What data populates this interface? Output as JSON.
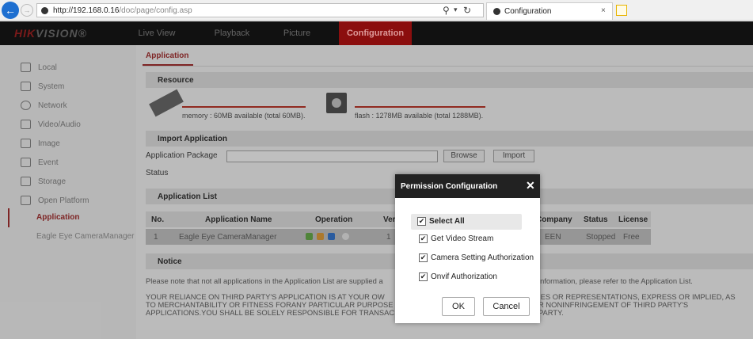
{
  "browser": {
    "url_host": "http://192.168.0.16",
    "url_path": "/doc/page/config.asp",
    "tab_title": "Configuration",
    "tab_close": "×"
  },
  "app": {
    "logo_red": "HIK",
    "logo_rest": "VISION",
    "logo_mark": "®",
    "nav": [
      "Live View",
      "Playback",
      "Picture",
      "Configuration"
    ],
    "accent": "#8b0e0e"
  },
  "sidebar": {
    "items": [
      {
        "label": "Local",
        "icon": "monitor-icon"
      },
      {
        "label": "System",
        "icon": "system-icon"
      },
      {
        "label": "Network",
        "icon": "globe-icon"
      },
      {
        "label": "Video/Audio",
        "icon": "video-audio-icon"
      },
      {
        "label": "Image",
        "icon": "image-icon"
      },
      {
        "label": "Event",
        "icon": "event-icon"
      },
      {
        "label": "Storage",
        "icon": "storage-icon"
      },
      {
        "label": "Open Platform",
        "icon": "platform-icon"
      }
    ],
    "subitems": [
      "Application",
      "Eagle Eye CameraManager"
    ]
  },
  "main": {
    "page_tab": "Application",
    "resource_title": "Resource",
    "memory_text": "memory : 60MB available (total 60MB).",
    "flash_text": "flash : 1278MB available (total 1288MB).",
    "import_title": "Import Application",
    "package_label": "Application Package",
    "browse_label": "Browse",
    "import_label": "Import",
    "status_label": "Status",
    "list_title": "Application List",
    "table": {
      "headers": [
        "No.",
        "Application Name",
        "Operation",
        "Ver",
        "Company",
        "Status",
        "License"
      ],
      "row": {
        "no": "1",
        "name": "Eagle Eye CameraManager",
        "ver": "1",
        "company": "EEN",
        "status": "Stopped",
        "license": "Free"
      }
    },
    "notice_title": "Notice",
    "notice_line1a": "Please note that not all applications in the Application List are supplied a",
    "notice_line1b": "information, please refer to the Application List.",
    "notice_line2a": "YOUR RELIANCE ON THIRD PARTY'S APPLICATION IS AT YOUR OW",
    "notice_line2b": "IES OR REPRESENTATIONS, EXPRESS OR IMPLIED, AS",
    "notice_line3a": "TO MERCHANTABILITY OR FITNESS FORANY PARTICULAR PURPOSE",
    "notice_line3b": "R NONINFRINGEMENT OF THIRD PARTY'S",
    "notice_line4a": "APPLICATIONS.YOU SHALL BE SOLELY RESPONSIBLE FOR TRANSAC",
    "notice_line4b": "PARTY."
  },
  "modal": {
    "title": "Permission Configuration",
    "close": "✕",
    "options": [
      {
        "label": "Select All",
        "checked": true
      },
      {
        "label": "Get Video Stream",
        "checked": true
      },
      {
        "label": "Camera Setting Authorization",
        "checked": true
      },
      {
        "label": "Onvif Authorization",
        "checked": true
      }
    ],
    "ok": "OK",
    "cancel": "Cancel"
  }
}
